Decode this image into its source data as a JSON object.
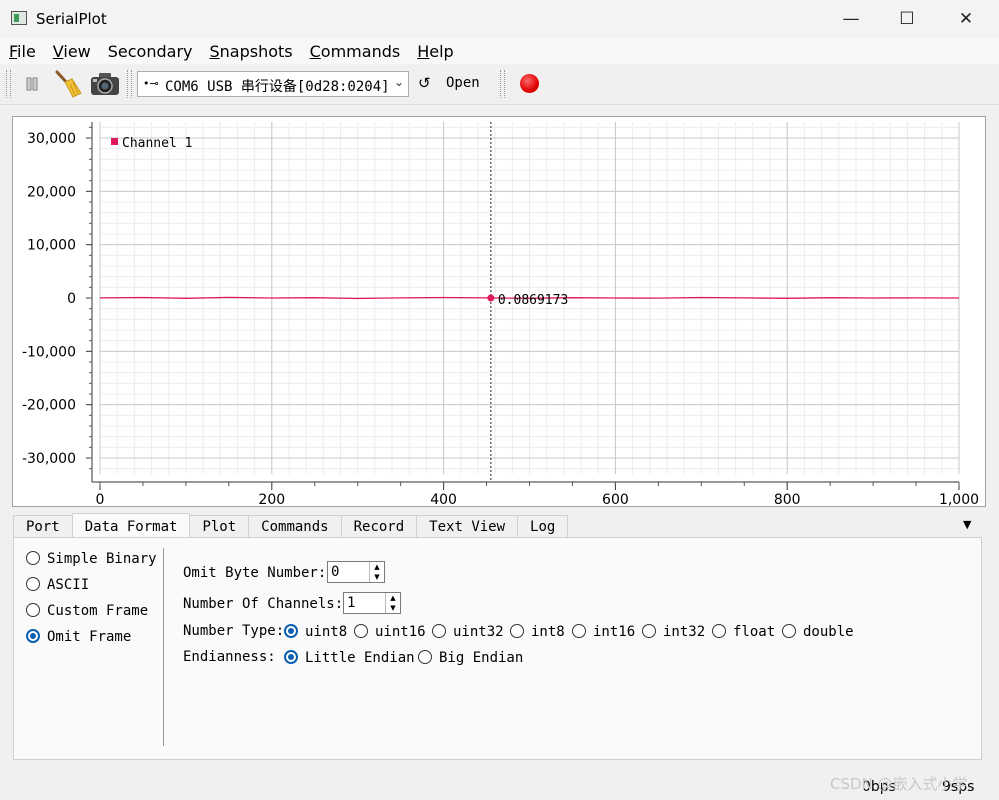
{
  "window": {
    "title": "SerialPlot",
    "minimize": "—",
    "maximize": "☐",
    "close": "✕"
  },
  "menu": {
    "file": "File",
    "view": "View",
    "secondary": "Secondary",
    "snapshots": "Snapshots",
    "commands": "Commands",
    "help": "Help",
    "file_mn": "F",
    "file_rest": "ile",
    "view_mn": "V",
    "view_rest": "iew",
    "snap_mn": "S",
    "snap_rest": "napshots",
    "cmd_mn": "C",
    "cmd_rest": "ommands",
    "help_mn": "H",
    "help_rest": "elp"
  },
  "toolbar": {
    "port_value": "COM6 USB 串行设备[0d28:0204]",
    "open_label": "Open",
    "usb_glyph": "•⊸",
    "refresh_glyph": "↺",
    "chevron": "⌄",
    "icons": [
      "pause-icon",
      "broom-clear-icon",
      "camera-snapshot-icon",
      "usb-icon",
      "refresh-icon",
      "record-icon"
    ]
  },
  "chart_data": {
    "type": "line",
    "xlim": [
      0,
      1000
    ],
    "ylim": [
      -33000,
      33000
    ],
    "x_ticks": [
      0,
      200,
      400,
      600,
      800,
      1000
    ],
    "x_tick_labels": [
      "0",
      "200",
      "400",
      "600",
      "800",
      "1,000"
    ],
    "y_ticks": [
      30000,
      20000,
      10000,
      0,
      -10000,
      -20000,
      -30000
    ],
    "y_tick_labels": [
      "30,000",
      "20,000",
      "10,000",
      "0",
      "-10,000",
      "-20,000",
      "-30,000"
    ],
    "grid": true,
    "legend": "top-left",
    "series": [
      {
        "name": "Channel 1",
        "color": "#e0195a",
        "x": [
          0,
          50,
          100,
          150,
          200,
          250,
          300,
          350,
          400,
          450,
          500,
          550,
          600,
          650,
          700,
          750,
          800,
          850,
          900,
          950,
          1000
        ],
        "y": [
          0.1,
          0.3,
          -0.2,
          0.4,
          0.0,
          0.2,
          -0.3,
          0.1,
          0.3,
          0.09,
          -0.2,
          0.2,
          0.0,
          -0.1,
          0.3,
          0.1,
          -0.2,
          0.2,
          0.0,
          0.1,
          0.0
        ]
      }
    ],
    "cursor": {
      "x": 455,
      "y": 0.0869173,
      "label": "0.0869173"
    }
  },
  "tabs": [
    "Port",
    "Data Format",
    "Plot",
    "Commands",
    "Record",
    "Text View",
    "Log"
  ],
  "tab_menu": "▼",
  "data_format": {
    "formats": [
      "Simple Binary",
      "ASCII",
      "Custom Frame",
      "Omit Frame"
    ],
    "selected_format": "Omit Frame",
    "omit_byte_label": "Omit Byte Number:",
    "omit_byte_value": "0",
    "channels_label": "Number Of Channels:",
    "channels_value": "1",
    "number_type_label": "Number Type:",
    "number_types": [
      "uint8",
      "uint16",
      "uint32",
      "int8",
      "int16",
      "int32",
      "float",
      "double"
    ],
    "selected_number_type": "uint8",
    "endianness_label": "Endianness:",
    "endianness": [
      "Little Endian",
      "Big Endian"
    ],
    "selected_endianness": "Little Endian",
    "spin_up": "▲",
    "spin_down": "▼"
  },
  "status": {
    "rate_bps": "0bps",
    "rate_sps": "9sps",
    "watermark": "CSDN @嵌入式小学"
  }
}
